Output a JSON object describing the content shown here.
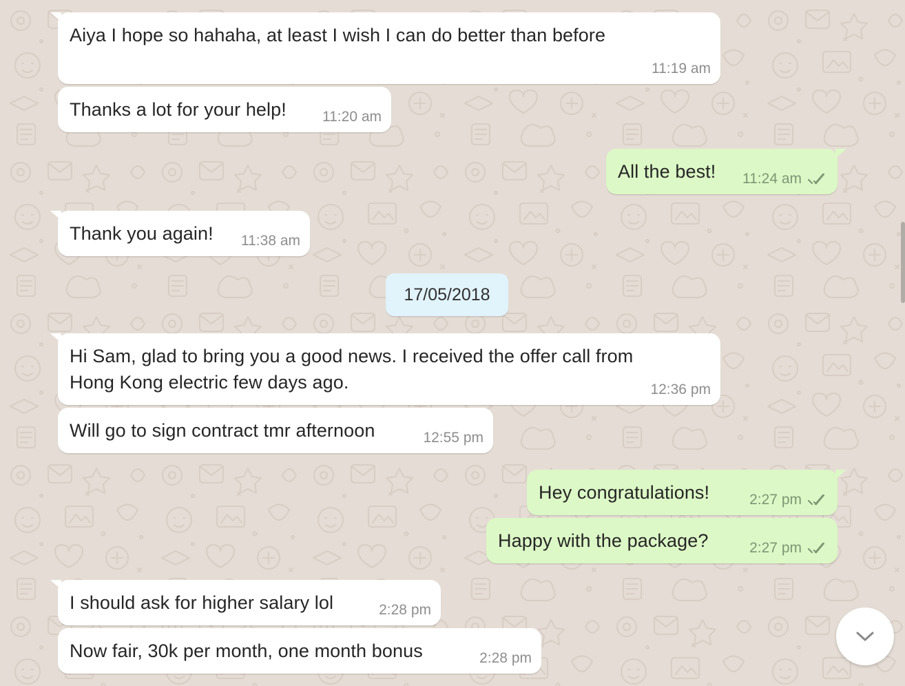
{
  "colors": {
    "chat_background": "#e5ddd5",
    "incoming_bubble": "#ffffff",
    "outgoing_bubble": "#dcf8c6",
    "date_chip": "#e1f3fb",
    "read_ticks": "#7d9674"
  },
  "messages": [
    {
      "direction": "incoming",
      "text": "Aiya I hope so hahaha, at least I wish I can do better than before",
      "time": "11:19 am"
    },
    {
      "direction": "incoming",
      "text": "Thanks a lot for your help!",
      "time": "11:20 am"
    },
    {
      "direction": "outgoing",
      "text": "All the best!",
      "time": "11:24 am",
      "status_icon": "double-tick-icon"
    },
    {
      "direction": "incoming",
      "text": "Thank you again!",
      "time": "11:38 am"
    },
    {
      "direction": "incoming",
      "text": "Hi Sam, glad to bring you a good news. I received the offer call from",
      "text2": "Hong Kong electric few days ago.",
      "time": "12:36 pm"
    },
    {
      "direction": "incoming",
      "text": "Will go to sign contract tmr afternoon",
      "time": "12:55 pm"
    },
    {
      "direction": "outgoing",
      "text": "Hey congratulations!",
      "time": "2:27 pm",
      "status_icon": "double-tick-icon"
    },
    {
      "direction": "outgoing",
      "text": "Happy with the package?",
      "time": "2:27 pm",
      "status_icon": "double-tick-icon"
    },
    {
      "direction": "incoming",
      "text": "I should ask for higher salary lol",
      "time": "2:28 pm"
    },
    {
      "direction": "incoming",
      "text": "Now fair, 30k per month, one month bonus",
      "time": "2:28 pm"
    }
  ],
  "date_separator": "17/05/2018",
  "scroll_down_button": {
    "icon": "chevron-down-icon"
  }
}
